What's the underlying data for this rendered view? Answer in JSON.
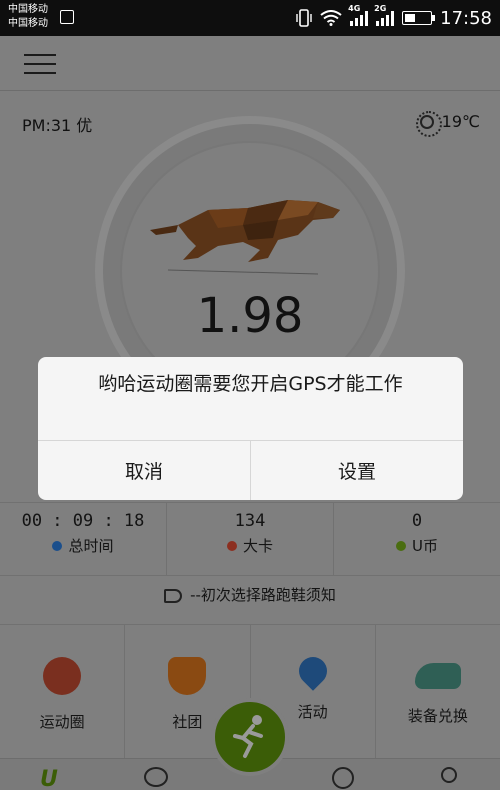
{
  "status_bar": {
    "carrier_1": "中国移动",
    "carrier_2": "中国移动",
    "net_1": "4G",
    "net_2": "2G",
    "time": "17:58"
  },
  "header": {
    "pm": "PM:31 优",
    "temperature": "19℃"
  },
  "run": {
    "distance": "1.98"
  },
  "stats": [
    {
      "value": "00 : 09 : 18",
      "label": "总时间",
      "color": "#1b4f8c"
    },
    {
      "value": "134",
      "label": "大卡",
      "color": "#8c2f20"
    },
    {
      "value": "0",
      "label": "U币",
      "color": "#4a6d10"
    }
  ],
  "notice": "--初次选择路跑鞋须知",
  "features": [
    {
      "label": "运动圈",
      "icon": "circles-icon"
    },
    {
      "label": "社团",
      "icon": "badge-icon"
    },
    {
      "label": "活动",
      "icon": "location-pin-icon"
    },
    {
      "label": "装备兑换",
      "icon": "shoe-icon"
    }
  ],
  "dialog": {
    "message": "哟哈运动圈需要您开启GPS才能工作",
    "cancel": "取消",
    "settings": "设置"
  },
  "colors": {
    "dialog_bg": "#f5f5f5",
    "run_button": "#3b5d07"
  }
}
